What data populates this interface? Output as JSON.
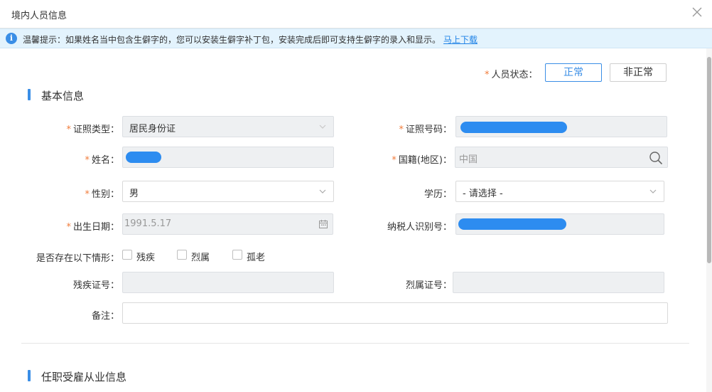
{
  "window": {
    "title": "境内人员信息"
  },
  "notice": {
    "icon": "info-icon",
    "text": "温馨提示：如果姓名当中包含生僻字的，您可以安装生僻字补丁包，安装完成后即可支持生僻字的录入和显示。",
    "link": "马上下载"
  },
  "status": {
    "label": "人员状态：",
    "options": [
      "正常",
      "非正常"
    ],
    "selected": "正常"
  },
  "basic": {
    "section_title": "基本信息",
    "id_type": {
      "label": "证照类型：",
      "value": "居民身份证"
    },
    "id_number": {
      "label": "证照号码："
    },
    "name": {
      "label": "姓名："
    },
    "nationality": {
      "label": "国籍(地区)：",
      "value": "中国"
    },
    "gender": {
      "label": "性别：",
      "value": "男"
    },
    "education": {
      "label": "学历：",
      "value": "- 请选择 -"
    },
    "birth_date": {
      "label": "出生日期：",
      "value": "1991.5.17"
    },
    "taxpayer_id": {
      "label": "纳税人识别号："
    },
    "conditions": {
      "label": "是否存在以下情形：",
      "options": [
        "残疾",
        "烈属",
        "孤老"
      ]
    },
    "disability_cert": {
      "label": "残疾证号："
    },
    "martyr_cert": {
      "label": "烈属证号："
    },
    "remarks": {
      "label": "备注："
    }
  },
  "employment": {
    "section_title": "任职受雇从业信息"
  },
  "colors": {
    "accent": "#3a8ee6",
    "required": "#f17b3a",
    "notice_bg": "#e3f3fd",
    "disabled_bg": "#eef0f2",
    "redaction": "#2d8cf0"
  }
}
